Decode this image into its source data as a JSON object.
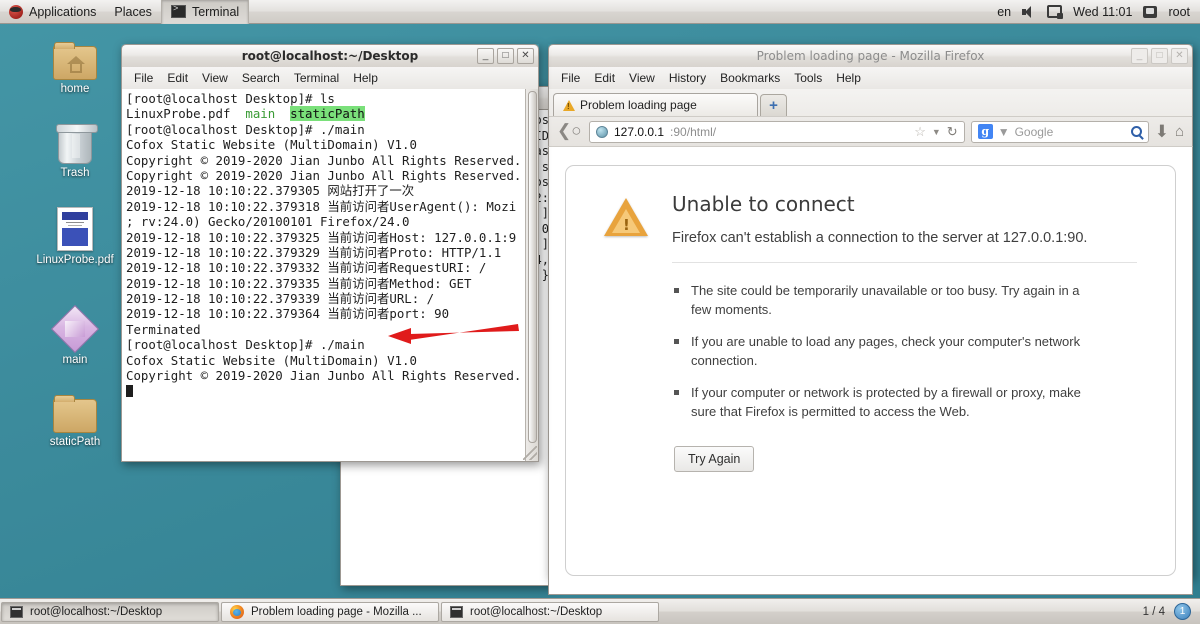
{
  "top_panel": {
    "applications": "Applications",
    "places": "Places",
    "active_window": "Terminal",
    "keyboard_layout": "en",
    "clock": "Wed 11:01",
    "user": "root",
    "icons": {
      "logo": "redhat-logo-icon",
      "volume": "volume-icon",
      "network": "network-disconnected-icon",
      "user": "user-icon"
    }
  },
  "desktop_icons": [
    {
      "label": "home",
      "icon": "home-folder-icon"
    },
    {
      "label": "Trash",
      "icon": "trash-icon"
    },
    {
      "label": "LinuxProbe.pdf",
      "icon": "pdf-document-icon"
    },
    {
      "label": "main",
      "icon": "executable-binary-icon"
    },
    {
      "label": "staticPath",
      "icon": "folder-icon"
    }
  ],
  "terminal_back": {
    "title": "root@localhost:~/Desktop",
    "lines": [
      "",
      "",
      "",
      "",
      "",
      "",
      "os",
      "ID",
      "as",
      "s",
      "os",
      "",
      "2:",
      "]",
      ".0",
      "]",
      "4,",
      "}"
    ]
  },
  "terminal": {
    "title": "root@localhost:~/Desktop",
    "menu": [
      "File",
      "Edit",
      "View",
      "Search",
      "Terminal",
      "Help"
    ],
    "window_buttons": {
      "minimize": "_",
      "maximize": "□",
      "close": "✕"
    },
    "lines": [
      {
        "segments": [
          {
            "t": "[root@localhost Desktop]# ls",
            "c": "plain"
          }
        ]
      },
      {
        "segments": [
          {
            "t": "LinuxProbe.pdf  ",
            "c": "plain"
          },
          {
            "t": "main",
            "c": "green"
          },
          {
            "t": "  ",
            "c": "plain"
          },
          {
            "t": "staticPath",
            "c": "hl"
          }
        ]
      },
      {
        "segments": [
          {
            "t": "[root@localhost Desktop]# ./main",
            "c": "plain"
          }
        ]
      },
      {
        "segments": [
          {
            "t": "Cofox Static Website (MultiDomain) V1.0",
            "c": "plain"
          }
        ]
      },
      {
        "segments": [
          {
            "t": "Copyright © 2019-2020 Jian Junbo All Rights Reserved.",
            "c": "plain"
          }
        ]
      },
      {
        "segments": [
          {
            "t": "Copyright © 2019-2020 Jian Junbo All Rights Reserved.",
            "c": "plain"
          }
        ]
      },
      {
        "segments": [
          {
            "t": "2019-12-18 10:10:22.379305 网站打开了一次",
            "c": "plain"
          }
        ]
      },
      {
        "segments": [
          {
            "t": "2019-12-18 10:10:22.379318 当前访问者UserAgent(): Mozi",
            "c": "plain"
          }
        ]
      },
      {
        "segments": [
          {
            "t": "; rv:24.0) Gecko/20100101 Firefox/24.0",
            "c": "plain"
          }
        ]
      },
      {
        "segments": [
          {
            "t": "2019-12-18 10:10:22.379325 当前访问者Host: 127.0.0.1:9",
            "c": "plain"
          }
        ]
      },
      {
        "segments": [
          {
            "t": "2019-12-18 10:10:22.379329 当前访问者Proto: HTTP/1.1",
            "c": "plain"
          }
        ]
      },
      {
        "segments": [
          {
            "t": "2019-12-18 10:10:22.379332 当前访问者RequestURI: /",
            "c": "plain"
          }
        ]
      },
      {
        "segments": [
          {
            "t": "2019-12-18 10:10:22.379335 当前访问者Method: GET",
            "c": "plain"
          }
        ]
      },
      {
        "segments": [
          {
            "t": "2019-12-18 10:10:22.379339 当前访问者URL: /",
            "c": "plain"
          }
        ]
      },
      {
        "segments": [
          {
            "t": "2019-12-18 10:10:22.379364 当前访问者port: 90",
            "c": "plain"
          }
        ]
      },
      {
        "segments": [
          {
            "t": "Terminated",
            "c": "plain"
          }
        ]
      },
      {
        "segments": [
          {
            "t": "[root@localhost Desktop]# ./main",
            "c": "plain"
          }
        ]
      },
      {
        "segments": [
          {
            "t": "Cofox Static Website (MultiDomain) V1.0",
            "c": "plain"
          }
        ]
      },
      {
        "segments": [
          {
            "t": "Copyright © 2019-2020 Jian Junbo All Rights Reserved.",
            "c": "plain"
          }
        ]
      },
      {
        "segments": [
          {
            "t": "",
            "c": "caret"
          }
        ]
      }
    ]
  },
  "annotation": {
    "arrow_color": "#e01b1b",
    "points_to": "./main command line"
  },
  "firefox": {
    "title": "Problem loading page - Mozilla Firefox",
    "menu": [
      "File",
      "Edit",
      "View",
      "History",
      "Bookmarks",
      "Tools",
      "Help"
    ],
    "window_buttons": {
      "minimize": "_",
      "maximize": "□",
      "close": "✕"
    },
    "tab": {
      "label": "Problem loading page",
      "icon": "warning-icon"
    },
    "new_tab_label": "+",
    "url": {
      "host": "127.0.0.1",
      "rest": ":90/html/"
    },
    "search": {
      "engine": "Google",
      "placeholder": "Google"
    },
    "error_page": {
      "heading": "Unable to connect",
      "subheading": "Firefox can't establish a connection to the server at 127.0.0.1:90.",
      "bullets": [
        "The site could be temporarily unavailable or too busy. Try again in a few moments.",
        "If you are unable to load any pages, check your computer's network connection.",
        "If your computer or network is protected by a firewall or proxy, make sure that Firefox is permitted to access the Web."
      ],
      "button": "Try Again"
    }
  },
  "bottom_panel": {
    "tasks": [
      {
        "label": "root@localhost:~/Desktop",
        "icon": "terminal-icon",
        "pressed": true
      },
      {
        "label": "Problem loading page - Mozilla ...",
        "icon": "firefox-icon",
        "pressed": false
      },
      {
        "label": "root@localhost:~/Desktop",
        "icon": "terminal-icon",
        "pressed": false
      }
    ],
    "workspace_count": "1 / 4",
    "workspace_current": "1"
  }
}
